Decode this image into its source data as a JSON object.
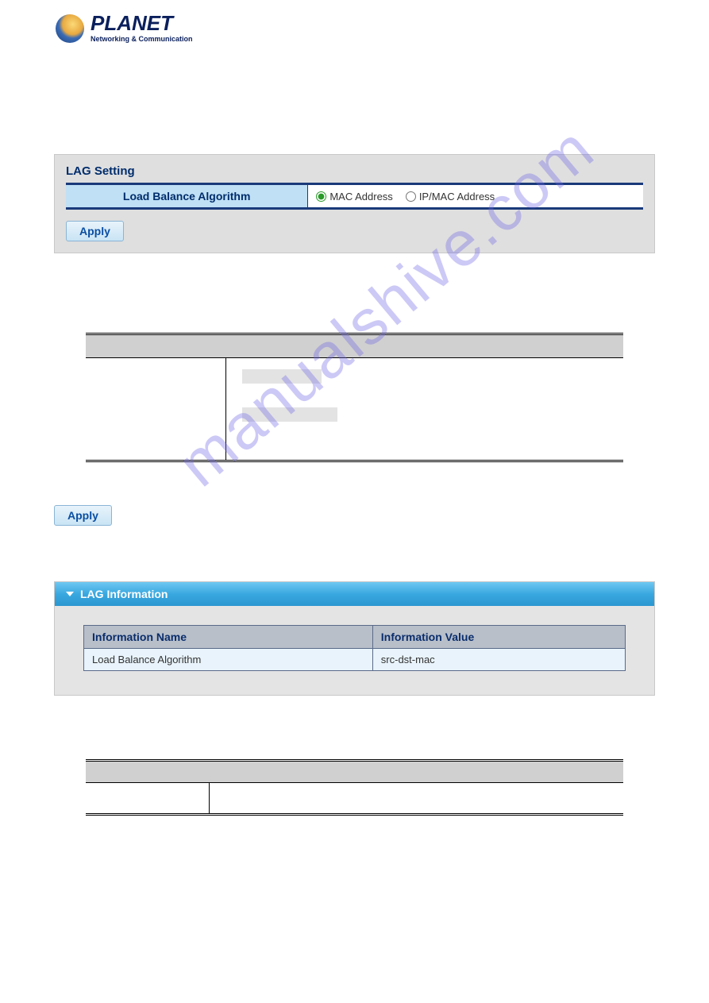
{
  "logo": {
    "brand": "PLANET",
    "tagline": "Networking & Communication"
  },
  "watermark": "manualshive.com",
  "lag_setting": {
    "title": "LAG Setting",
    "label": "Load Balance Algorithm",
    "options": {
      "mac": "MAC Address",
      "ipmac": "IP/MAC Address"
    },
    "apply": "Apply"
  },
  "standalone_apply": "Apply",
  "lag_info": {
    "header": "LAG Information",
    "col_name": "Information Name",
    "col_value": "Information Value",
    "row_name": "Load Balance Algorithm",
    "row_value": "src-dst-mac"
  }
}
